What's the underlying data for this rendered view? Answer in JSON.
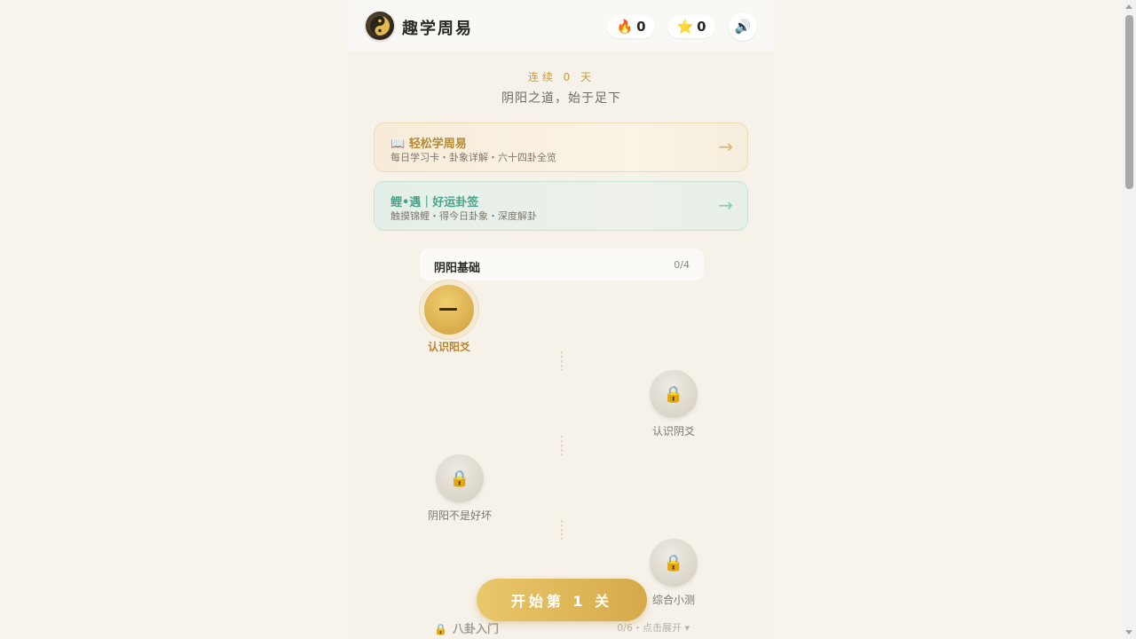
{
  "header": {
    "title": "趣学周易",
    "fire_icon": "🔥",
    "fire_count": "0",
    "star_icon": "⭐",
    "star_count": "0",
    "sound_icon": "🔊"
  },
  "hero": {
    "streak": "连续 0 天",
    "motto": "阴阳之道，始于足下"
  },
  "cards": {
    "learn": {
      "title": "📖 轻松学周易",
      "desc": "每日学习卡・卦象详解・六十四卦全览",
      "arrow": "→"
    },
    "fortune": {
      "title": "鲤•遇｜好运卦签",
      "desc": "触摸锦鲤・得今日卦象・深度解卦",
      "arrow": "→"
    }
  },
  "section": {
    "title": "阴阳基础",
    "progress": "0/4",
    "nodes": [
      {
        "label": "认识阳爻",
        "state": "active",
        "glyph": "—"
      },
      {
        "label": "认识阴爻",
        "state": "locked",
        "glyph": "🔒"
      },
      {
        "label": "阴阳不是好坏",
        "state": "locked",
        "glyph": "🔒"
      },
      {
        "label": "综合小测",
        "state": "locked",
        "glyph": "🔒"
      }
    ]
  },
  "start_button": "开始第 1 关",
  "next_section": {
    "lock_icon": "🔒",
    "title": "八卦入门",
    "meta": "0/6・点击展开 ▾"
  },
  "colors": {
    "accent_gold": "#d5a94a",
    "jade": "#4aa38d",
    "background": "#f6f2ea"
  }
}
